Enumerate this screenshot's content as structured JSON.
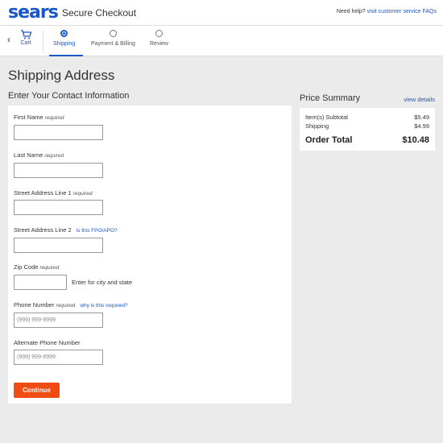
{
  "header": {
    "logo": "sears",
    "title": "Secure Checkout",
    "help_prefix": "Need help?",
    "help_link": "visit customer service FAQs"
  },
  "steps": {
    "cart_label": "Cart",
    "items": [
      {
        "label": "Shipping",
        "active": true
      },
      {
        "label": "Payment & Billing",
        "active": false
      },
      {
        "label": "Review",
        "active": false
      }
    ]
  },
  "page": {
    "title": "Shipping Address",
    "section_title": "Enter Your Contact Information"
  },
  "form": {
    "first_name_label": "First Name",
    "last_name_label": "Last Name",
    "street1_label": "Street Address Line 1",
    "street2_label": "Street Address Line 2",
    "street2_link": "is this FPO/APO?",
    "zip_label": "Zip Code",
    "zip_hint": "Enter for city and state",
    "phone_label": "Phone Number",
    "phone_link": "why is this required?",
    "phone_placeholder": "(999) 999-9999",
    "alt_phone_label": "Alternate Phone Number",
    "alt_phone_placeholder": "(999) 999-9999",
    "required_text": "required",
    "continue_label": "Continue"
  },
  "price_summary": {
    "title": "Price Summary",
    "view_details": "view details",
    "subtotal_label": "Item(s) Subtotal",
    "subtotal_value": "$5.49",
    "shipping_label": "Shipping",
    "shipping_value": "$4.99",
    "total_label": "Order Total",
    "total_value": "$10.48"
  },
  "colors": {
    "brand": "#1a57c6",
    "cta": "#f04d14",
    "background": "#ebebeb"
  }
}
